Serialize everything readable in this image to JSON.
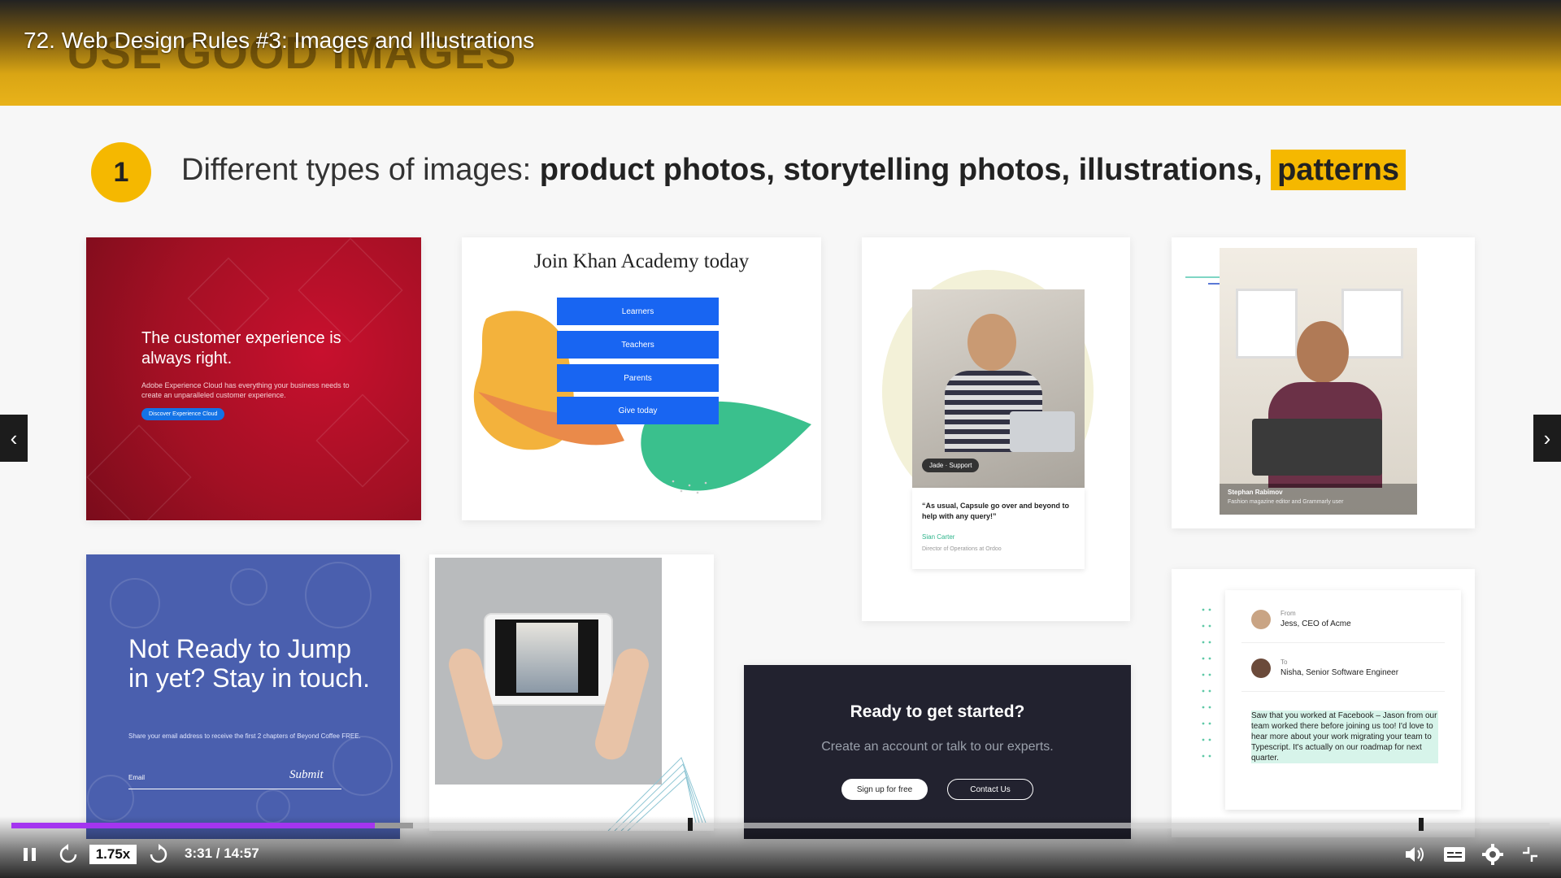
{
  "video": {
    "title": "72. Web Design Rules #3: Images and Illustrations",
    "slide_background_title": "USE GOOD IMAGES"
  },
  "slide": {
    "number": "1",
    "heading_intro": "Different types of images: ",
    "heading_bold": "product photos, storytelling photos, illustrations, ",
    "heading_highlight": "patterns"
  },
  "cards": {
    "adobe": {
      "title": "The customer experience is always right.",
      "subtitle": "Adobe Experience Cloud has everything your business needs to create an unparalleled customer experience.",
      "button": "Discover Experience Cloud"
    },
    "khan": {
      "title": "Join Khan Academy today",
      "buttons": [
        "Learners",
        "Teachers",
        "Parents",
        "Give today"
      ]
    },
    "capsule": {
      "tag": "Jade · Support",
      "quote": "“As usual, Capsule go over and beyond to help with any query!”",
      "name": "Sian Carter",
      "role": "Director of Operations at Ordoo"
    },
    "grammarly": {
      "name": "Stephan Rabimov",
      "role": "Fashion magazine editor and Grammarly user"
    },
    "coffee": {
      "title": "Not Ready to Jump in yet? Stay in touch.",
      "subtitle": "Share your email address to receive the first 2 chapters of Beyond Coffee FREE.",
      "email_label": "Email",
      "submit": "Submit"
    },
    "ready": {
      "title": "Ready to get started?",
      "subtitle": "Create an account or talk to our experts.",
      "signup": "Sign up for free",
      "contact": "Contact Us"
    },
    "email": {
      "from_label": "From",
      "from_name": "Jess, CEO of Acme",
      "to_label": "To",
      "to_name": "Nisha, Senior Software Engineer",
      "body": "Saw that you worked at Facebook – Jason from our team worked there before joining us too! I'd love to hear more about your work migrating your team to Typescript. It's actually on our roadmap for next quarter."
    }
  },
  "player": {
    "speed": "1.75x",
    "time": "3:31 / 14:57",
    "progress_fraction": 0.236,
    "buffer_fraction": 0.261
  },
  "colors": {
    "accent": "#f5b800",
    "progress": "#a435f0"
  },
  "icons": [
    "pause-icon",
    "rewind-icon",
    "forward-icon",
    "volume-icon",
    "captions-icon",
    "settings-icon",
    "fullscreen-icon",
    "prev-arrow-icon",
    "next-arrow-icon"
  ]
}
